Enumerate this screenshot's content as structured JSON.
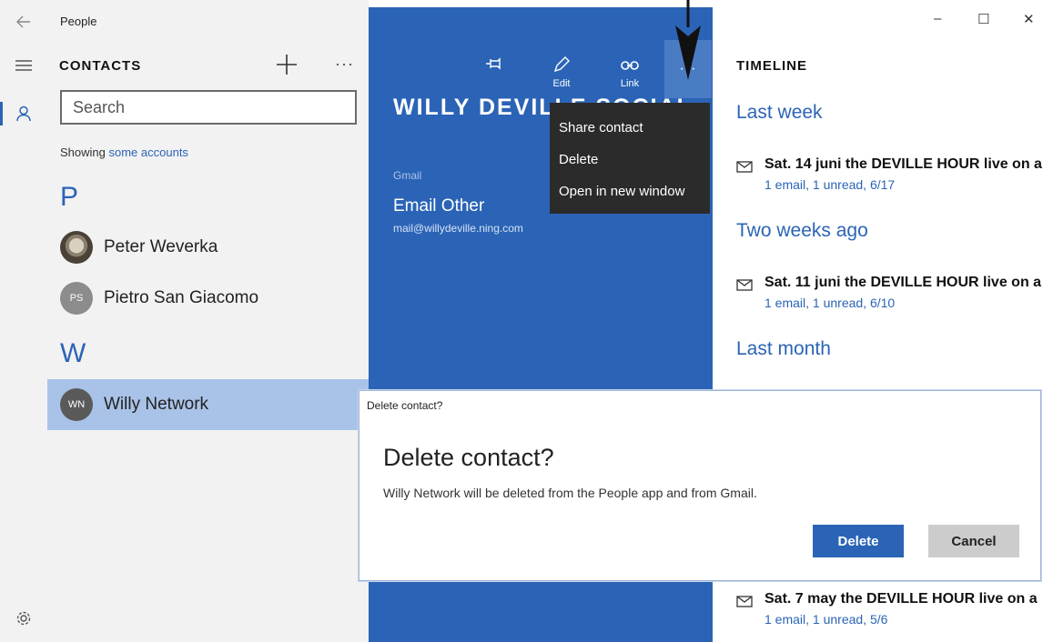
{
  "app": {
    "title": "People"
  },
  "contacts_pane": {
    "heading": "CONTACTS",
    "more": "···",
    "search_placeholder": "Search",
    "showing_prefix": "Showing",
    "showing_link": "some accounts",
    "groups": [
      {
        "letter": "P",
        "contacts": [
          {
            "name": "Peter Weverka",
            "initials": "",
            "avatar": "photo"
          },
          {
            "name": "Pietro San Giacomo",
            "initials": "PS",
            "avatar": "grey"
          }
        ]
      },
      {
        "letter": "W",
        "contacts": [
          {
            "name": "Willy Network",
            "initials": "WN",
            "avatar": "dark",
            "selected": true
          }
        ]
      }
    ]
  },
  "detail": {
    "toolbar": {
      "edit": "Edit",
      "link": "Link",
      "more": "···"
    },
    "title": "WILLY DEVILLE SOCIAL",
    "source_label": "Gmail",
    "email_label": "Email Other",
    "email_value": "mail@willydeville.ning.com"
  },
  "context_menu": {
    "items": [
      "Share contact",
      "Delete",
      "Open in new window"
    ]
  },
  "timeline": {
    "heading": "TIMELINE",
    "window_controls": {
      "minimize": "–",
      "maximize": "☐",
      "close": "✕"
    },
    "sections": [
      {
        "label": "Last week"
      },
      {
        "label": "Two weeks ago"
      },
      {
        "label": "Last month"
      }
    ],
    "items": [
      {
        "subject": "Sat. 14 juni the DEVILLE HOUR live on a",
        "meta": "1 email, 1 unread, 6/17"
      },
      {
        "subject": "Sat. 11 juni the DEVILLE HOUR live on a",
        "meta": "1 email, 1 unread, 6/10"
      },
      {
        "subject": "Sat. 7 may the DEVILLE HOUR live on a",
        "meta": "1 email, 1 unread, 5/6"
      }
    ]
  },
  "dialog": {
    "caption": "Delete contact?",
    "title": "Delete contact?",
    "body": "Willy Network will be deleted from the People app and from Gmail.",
    "confirm": "Delete",
    "cancel": "Cancel"
  },
  "colors": {
    "accent": "#2b64b6",
    "selected_row": "#a9c3e8",
    "menu_bg": "#2b2b2b"
  }
}
